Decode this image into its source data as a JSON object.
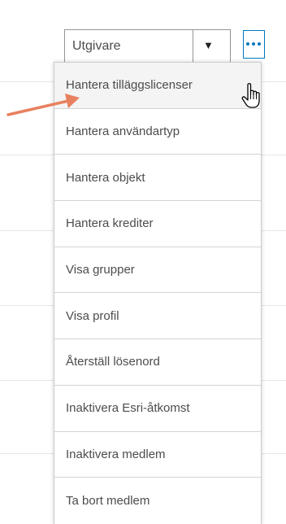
{
  "role_select": {
    "value": "Utgivare"
  },
  "more_button": {
    "icon": "ellipsis-icon"
  },
  "menu": {
    "items": [
      {
        "label": "Hantera tilläggslicenser"
      },
      {
        "label": "Hantera användartyp"
      },
      {
        "label": "Hantera objekt"
      },
      {
        "label": "Hantera krediter"
      },
      {
        "label": "Visa grupper"
      },
      {
        "label": "Visa profil"
      },
      {
        "label": "Återställ lösenord"
      },
      {
        "label": "Inaktivera Esri-åtkomst"
      },
      {
        "label": "Inaktivera medlem"
      },
      {
        "label": "Ta bort medlem"
      }
    ]
  },
  "colors": {
    "accent": "#0079c1",
    "annotation_arrow": "#e8815f",
    "text": "#4c4c4c"
  }
}
